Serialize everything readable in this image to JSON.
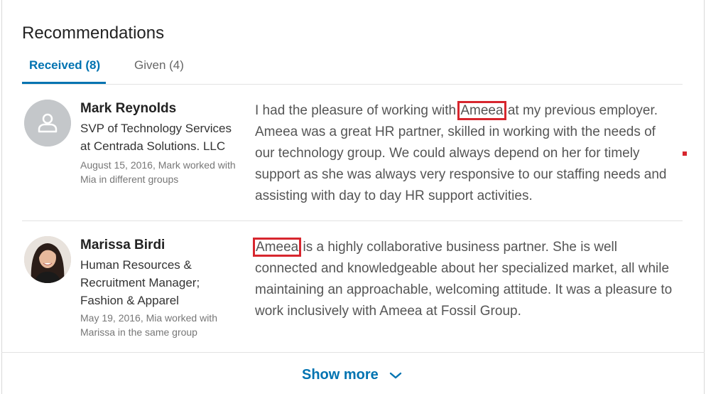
{
  "section": {
    "title": "Recommendations"
  },
  "tabs": [
    {
      "label": "Received (8)",
      "active": true
    },
    {
      "label": "Given (4)",
      "active": false
    }
  ],
  "recommendations": [
    {
      "name": "Mark Reynolds",
      "headline": "SVP of Technology Services at Centrada Solutions. LLC",
      "meta": "August 15, 2016, Mark worked with Mia in different groups",
      "text_before": "I had the pleasure of working with ",
      "highlight": "Ameea",
      "text_after": " at my previous employer. Ameea was a great HR partner, skilled in working with the needs of our technology group. We could always depend on her for timely support as she was always very responsive to our staffing needs and assisting with day to day HR support activities.",
      "avatar": "person-placeholder-icon"
    },
    {
      "name": "Marissa Birdi",
      "headline": "Human Resources & Recruitment Manager; Fashion & Apparel",
      "meta": "May 19, 2016, Mia worked with Marissa in the same group",
      "text_before": "",
      "highlight": "Ameea",
      "text_after": " is a highly collaborative business partner. She is well connected and knowledgeable about her specialized market, all while maintaining an approachable, welcoming attitude. It was a pleasure to work inclusively with Ameea at Fossil Group.",
      "avatar": "profile-photo"
    }
  ],
  "footer": {
    "show_more": "Show more",
    "icon": "chevron-down-icon"
  },
  "colors": {
    "accent": "#0073b1",
    "highlight_border": "#d7262e"
  }
}
